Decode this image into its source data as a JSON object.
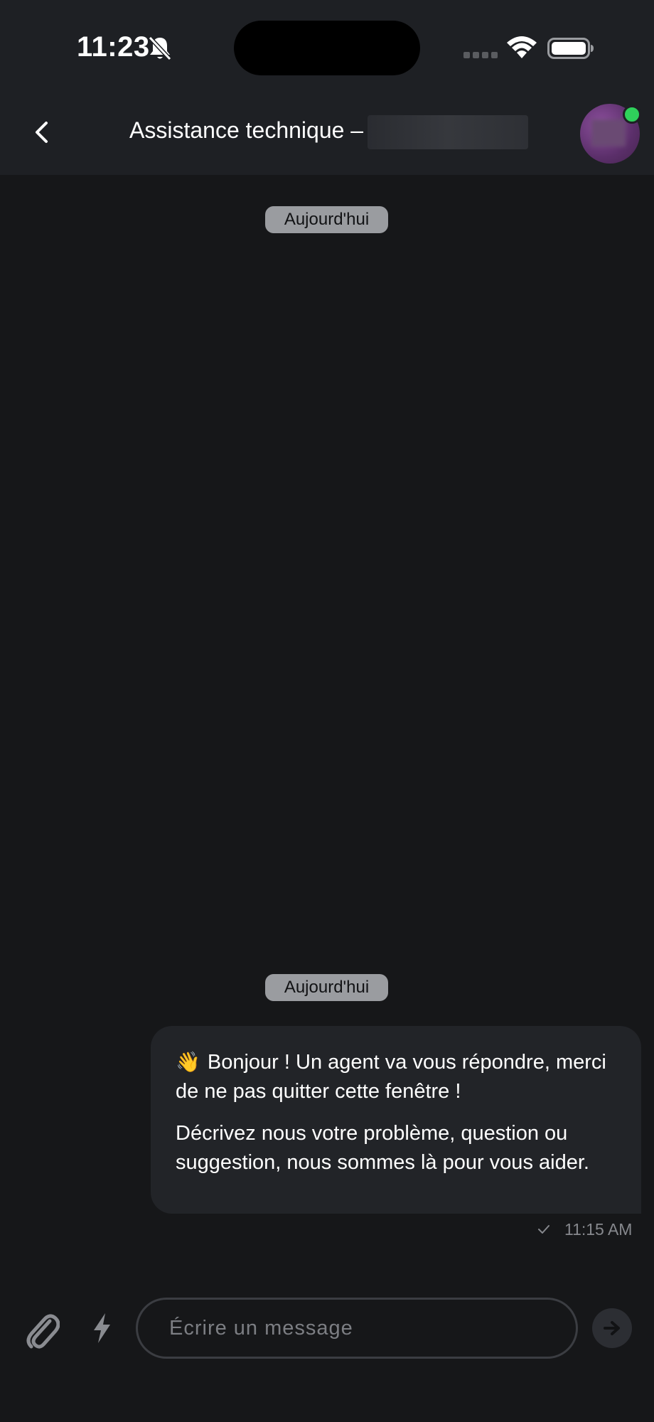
{
  "status_bar": {
    "time": "11:23",
    "icons": [
      "bell-slash-icon",
      "cellular-signal-icon",
      "wifi-icon",
      "battery-icon"
    ]
  },
  "header": {
    "title": "Assistance technique –",
    "back_icon": "chevron-left-icon",
    "avatar_status_color": "#2fd15b"
  },
  "chat": {
    "date_separators": [
      "Aujourd'hui",
      "Aujourd'hui"
    ],
    "messages": [
      {
        "emoji": "👋",
        "line1": "Bonjour ! Un agent va vous répondre, merci de ne pas quitter cette fenêtre !",
        "line2": "Décrivez nous votre problème, question ou suggestion, nous sommes là pour vous aider.",
        "time": "11:15 AM",
        "status_icon": "check-icon"
      }
    ]
  },
  "composer": {
    "placeholder": "Écrire un message",
    "attach_icon": "paperclip-icon",
    "quick_icon": "lightning-icon",
    "send_icon": "arrow-right-icon"
  },
  "colors": {
    "background": "#161719",
    "header": "#1e2024",
    "bubble": "#222428",
    "pill": "#9a9ca0",
    "online": "#2fd15b"
  }
}
